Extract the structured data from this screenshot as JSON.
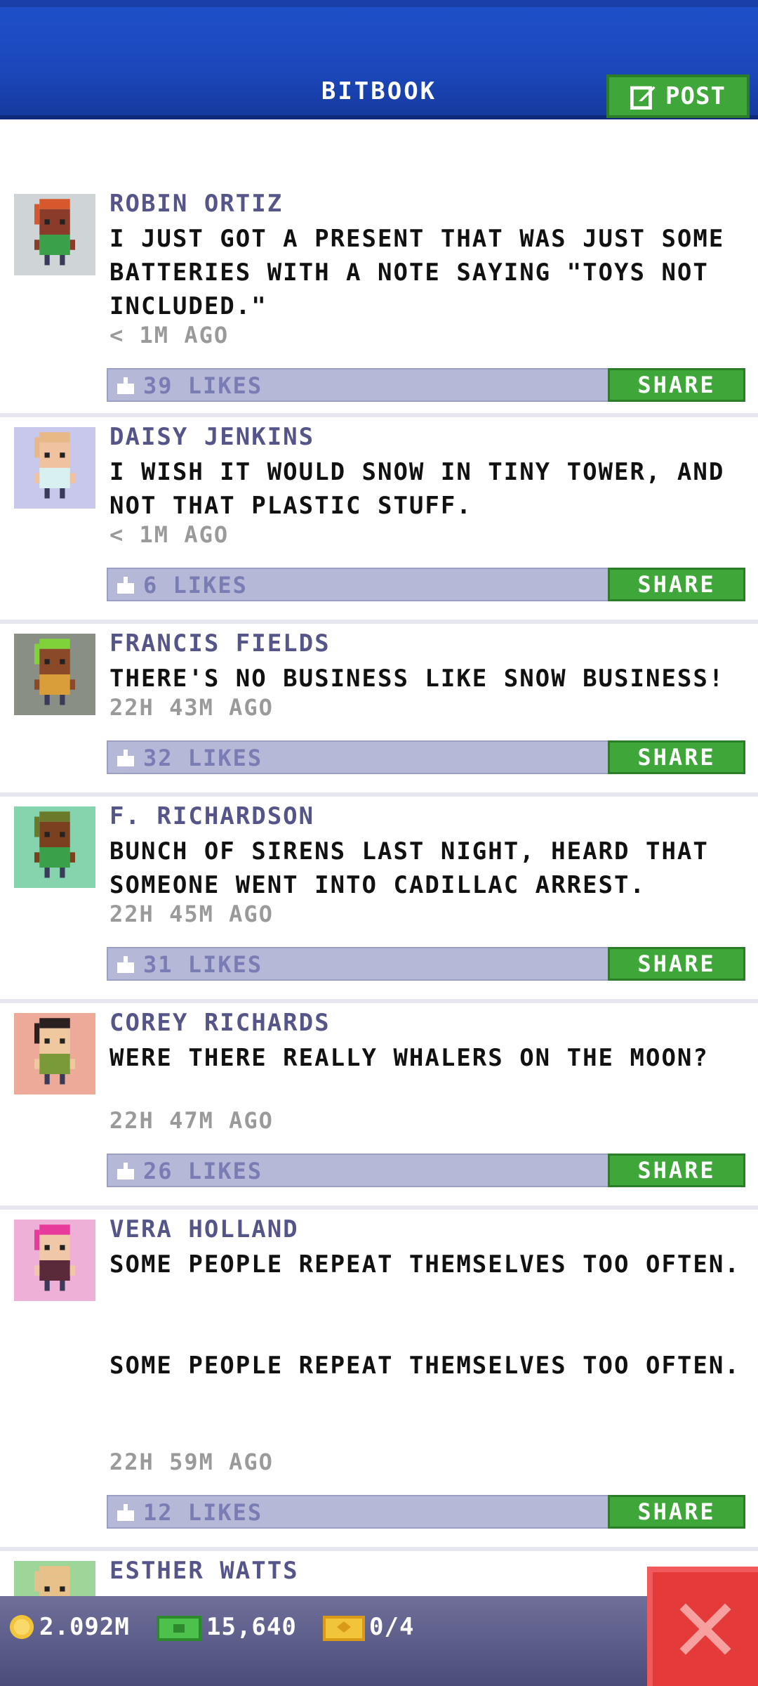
{
  "header": {
    "title": "BITBOOK",
    "post_label": "POST"
  },
  "posts": [
    {
      "name": "ROBIN ORTIZ",
      "text": "I JUST GOT A PRESENT THAT WAS JUST SOME BATTERIES WITH A NOTE SAYING \"TOYS NOT INCLUDED.\"",
      "time": "< 1M AGO",
      "likes": "39 LIKES",
      "share": "SHARE",
      "avatar_bg": "#cfd4d6",
      "skin": "#8a3b2a",
      "hair": "#d8582d",
      "shirt": "#3aa04a"
    },
    {
      "name": "DAISY JENKINS",
      "text": "I WISH IT WOULD SNOW IN TINY TOWER, AND NOT THAT PLASTIC STUFF.",
      "time": "< 1M AGO",
      "likes": "6 LIKES",
      "share": "SHARE",
      "avatar_bg": "#c7c8ec",
      "skin": "#f0c2a0",
      "hair": "#e8b886",
      "shirt": "#d8f0f0"
    },
    {
      "name": "FRANCIS FIELDS",
      "text": "THERE'S NO BUSINESS LIKE SNOW BUSINESS!",
      "time": "22H 43M AGO",
      "likes": "32 LIKES",
      "share": "SHARE",
      "avatar_bg": "#8a8f86",
      "skin": "#8a4a2a",
      "hair": "#7fd23a",
      "shirt": "#d99d3a"
    },
    {
      "name": "F. RICHARDSON",
      "text": "BUNCH OF SIRENS LAST NIGHT, HEARD THAT SOMEONE WENT INTO CADILLAC ARREST.",
      "time": "22H 45M AGO",
      "likes": "31 LIKES",
      "share": "SHARE",
      "avatar_bg": "#86d4ae",
      "skin": "#7a4020",
      "hair": "#6a7a2a",
      "shirt": "#3aa04a"
    },
    {
      "name": "COREY RICHARDS",
      "text": "WERE THERE REALLY WHALERS ON THE MOON?",
      "time": "22H 47M AGO",
      "likes": "26 LIKES",
      "share": "SHARE",
      "avatar_bg": "#eeaa98",
      "skin": "#f0c8a0",
      "hair": "#2a2020",
      "shirt": "#7a9a3a"
    },
    {
      "name": "VERA HOLLAND",
      "text": "SOME PEOPLE REPEAT THEMSELVES TOO OFTEN.\n\n\nSOME PEOPLE REPEAT THEMSELVES TOO OFTEN.",
      "time": "22H 59M AGO",
      "likes": "12 LIKES",
      "share": "SHARE",
      "avatar_bg": "#eeb0d6",
      "skin": "#f0c8a8",
      "hair": "#e83a9a",
      "shirt": "#5a2a3a"
    },
    {
      "name": "ESTHER WATTS",
      "text": "",
      "time": "",
      "likes": "",
      "share": "",
      "avatar_bg": "#9ed69a",
      "skin": "#e8c08a",
      "hair": "#e8c08a",
      "shirt": "#3aa04a"
    }
  ],
  "bottom_bar": {
    "coins": "2.092M",
    "bux": "15,640",
    "tickets": "0/4"
  },
  "colors": {
    "header": "#1f4fc8",
    "share_green": "#3fa63a",
    "likes_bar": "#b6b8d8",
    "close_red": "#e43a3a"
  },
  "icons": [
    "edit-icon",
    "like-icon",
    "coin-icon",
    "bux-icon",
    "ticket-icon",
    "close-icon"
  ]
}
